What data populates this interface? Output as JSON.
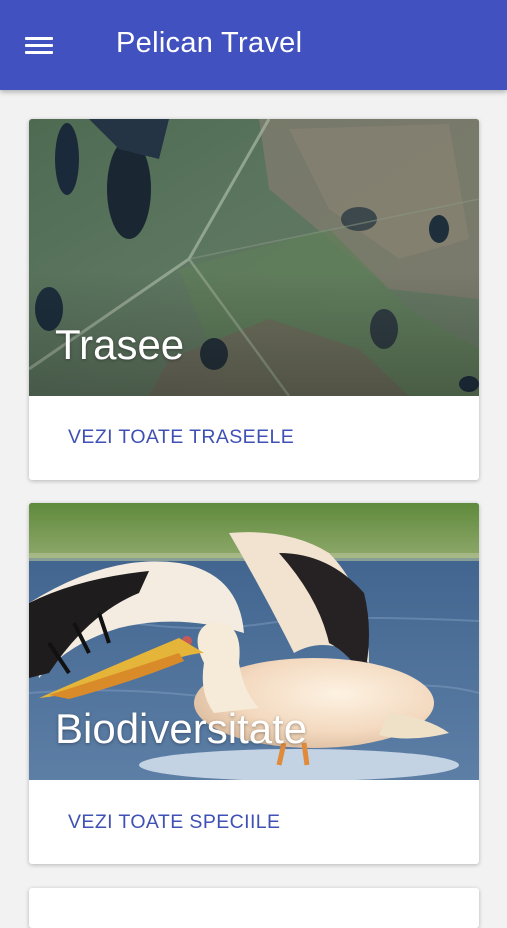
{
  "app_bar": {
    "menu_icon": "menu-icon",
    "title": "Pelican Travel",
    "color": "#4251c0"
  },
  "cards": [
    {
      "title": "Trasee",
      "action_label": "VEZI TOATE TRASEELE",
      "image": "aerial-delta-map-photo"
    },
    {
      "title": "Biodiversitate",
      "action_label": "VEZI TOATE SPECIILE",
      "image": "pelican-photo"
    }
  ],
  "accent_color": "#3f51b5"
}
